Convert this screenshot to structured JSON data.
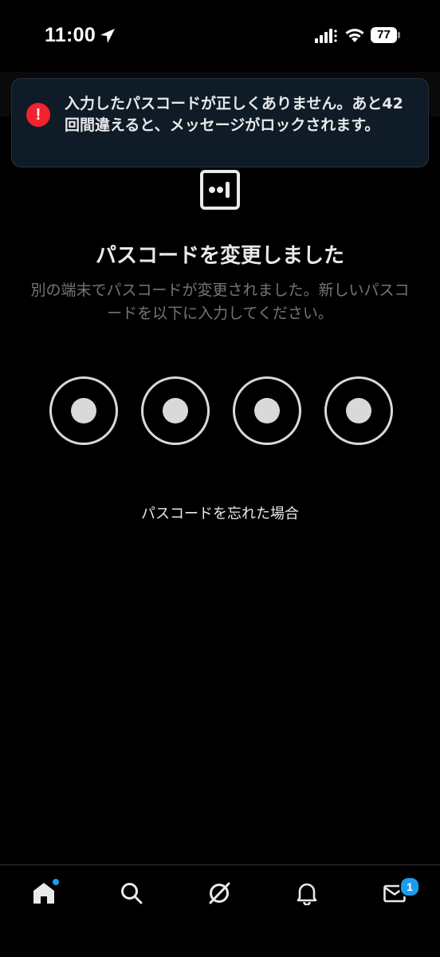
{
  "status_bar": {
    "time": "11:00",
    "battery_level": "77",
    "icons": [
      "location-arrow-icon",
      "signal-icon",
      "wifi-icon",
      "battery-icon"
    ]
  },
  "toast": {
    "icon": "error-icon",
    "icon_glyph": "!",
    "message": "入力したパスコードが正しくありません。あと42回間違えると、メッセージがロックされます。",
    "accent_color": "#f4212e"
  },
  "header": {
    "logo": "app-logo-icon",
    "title": "パスコードを変更しました",
    "subtitle": "別の端末でパスコードが変更されました。新しいパスコードを以下に入力してください。"
  },
  "passcode": {
    "length": 4,
    "filled": 4
  },
  "forgot_link": "パスコードを忘れた場合",
  "bottom_nav": {
    "items": [
      {
        "name": "home-icon",
        "has_dot": true
      },
      {
        "name": "search-icon"
      },
      {
        "name": "grok-icon"
      },
      {
        "name": "bell-icon"
      },
      {
        "name": "mail-icon",
        "badge": "1"
      }
    ],
    "accent_color": "#1d9bf0"
  }
}
